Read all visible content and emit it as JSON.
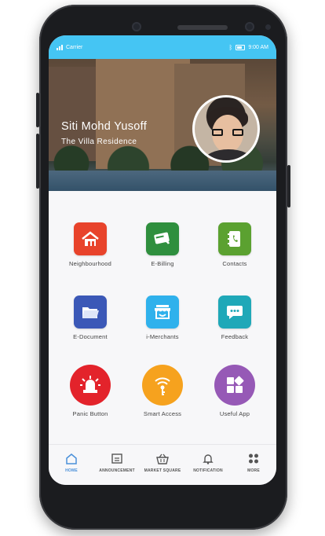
{
  "status_bar": {
    "carrier": "Carrier",
    "time": "9:00 AM"
  },
  "profile": {
    "name": "Siti Mohd Yusoff",
    "residence": "The Villa Residence"
  },
  "grid": [
    {
      "label": "Neighbourhood",
      "color": "#e8432b",
      "shape": "square",
      "icon": "house-icon"
    },
    {
      "label": "E-Billing",
      "color": "#2f8f3e",
      "shape": "square",
      "icon": "card-icon"
    },
    {
      "label": "Contacts",
      "color": "#5ba130",
      "shape": "square",
      "icon": "contacts-book-icon"
    },
    {
      "label": "E-Document",
      "color": "#3b58b7",
      "shape": "square",
      "icon": "folder-icon"
    },
    {
      "label": "i-Merchants",
      "color": "#2fb1ec",
      "shape": "square",
      "icon": "shop-icon"
    },
    {
      "label": "Feedback",
      "color": "#1fa8b8",
      "shape": "square",
      "icon": "chat-icon"
    },
    {
      "label": "Panic Button",
      "color": "#e3232b",
      "shape": "circle",
      "icon": "siren-icon"
    },
    {
      "label": "Smart Access",
      "color": "#f6a21e",
      "shape": "circle",
      "icon": "key-signal-icon"
    },
    {
      "label": "Useful App",
      "color": "#9659b6",
      "shape": "circle",
      "icon": "apps-icon"
    }
  ],
  "nav": [
    {
      "label": "HOME",
      "icon": "home-icon",
      "active": true
    },
    {
      "label": "ANNOUNCEMENT",
      "icon": "announcement-icon",
      "active": false
    },
    {
      "label": "MARKET SQUARE",
      "icon": "basket-icon",
      "active": false
    },
    {
      "label": "NOTIFICATION",
      "icon": "bell-icon",
      "active": false
    },
    {
      "label": "MORE",
      "icon": "more-dots-icon",
      "active": false
    }
  ],
  "colors": {
    "status_bar": "#45c5f3",
    "nav_active": "#4a90d9"
  }
}
